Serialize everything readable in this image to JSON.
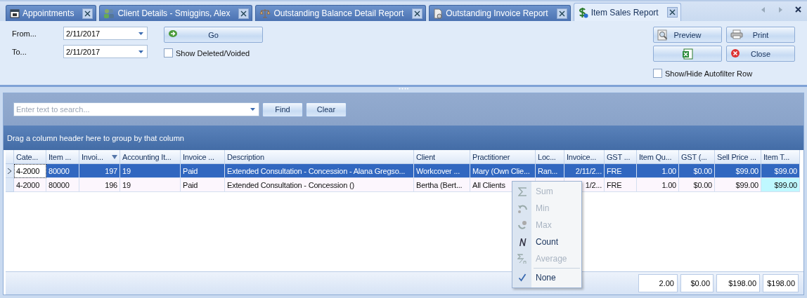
{
  "tabs": [
    {
      "label": "Appointments",
      "selected": false
    },
    {
      "label": "Client Details - Smiggins, Alex",
      "selected": false
    },
    {
      "label": "Outstanding Balance Detail Report",
      "selected": false
    },
    {
      "label": "Outstanding Invoice Report",
      "selected": false
    },
    {
      "label": "Item Sales Report",
      "selected": true
    }
  ],
  "filters": {
    "from_label": "From...",
    "from_value": "2/11/2017",
    "to_label": "To...",
    "to_value": "2/11/2017",
    "go_button": "Go",
    "show_deleted": {
      "label": "Show Deleted/Voided",
      "checked": false
    }
  },
  "actions": {
    "preview_button": "Preview",
    "print_button": "Print",
    "close_button": "Close",
    "autofilter": {
      "label": "Show/Hide Autofilter Row",
      "checked": false
    }
  },
  "search": {
    "placeholder": "Enter text to search...",
    "find_button": "Find",
    "clear_button": "Clear"
  },
  "group_panel": "Drag a column header here to group by that column",
  "table": {
    "columns": [
      {
        "label": "Cate...",
        "sorted": false
      },
      {
        "label": "Item ...",
        "sorted": false
      },
      {
        "label": "Invoi...",
        "sorted": true
      },
      {
        "label": "Accounting It...",
        "sorted": false
      },
      {
        "label": "Invoice ...",
        "sorted": false
      },
      {
        "label": "Description",
        "sorted": false
      },
      {
        "label": "Client",
        "sorted": false
      },
      {
        "label": "Practitioner",
        "sorted": false
      },
      {
        "label": "Loc...",
        "sorted": false
      },
      {
        "label": "Invoice...",
        "sorted": false
      },
      {
        "label": "GST ...",
        "sorted": false
      },
      {
        "label": "Item Qu...",
        "sorted": false
      },
      {
        "label": "GST (...",
        "sorted": false
      },
      {
        "label": "Sell Price ...",
        "sorted": false
      },
      {
        "label": "Item T...",
        "sorted": false
      }
    ],
    "rows": [
      {
        "selected": true,
        "cells": [
          "4-2000",
          "80000",
          "197",
          "19",
          "Paid",
          "Extended Consultation - Concession - Alana Gregso...",
          "Workcover ...",
          "Mary (Own Clie...",
          "Ran...",
          "2/11/2...",
          "FRE",
          "1.00",
          "$0.00",
          "$99.00",
          "$99.00"
        ]
      },
      {
        "selected": false,
        "cells": [
          "4-2000",
          "80000",
          "196",
          "19",
          "Paid",
          "Extended Consultation - Concession ()",
          "Bertha (Bert...",
          "All Clients",
          "",
          "1/2...",
          "FRE",
          "1.00",
          "$0.00",
          "$99.00",
          "$99.00"
        ]
      }
    ],
    "summary": [
      "2.00",
      "$0.00",
      "$198.00",
      "$198.00"
    ]
  },
  "summary_menu": {
    "items": [
      {
        "label": "Sum",
        "kind": "sum",
        "disabled": true,
        "checked": false
      },
      {
        "label": "Min",
        "kind": "min",
        "disabled": true,
        "checked": false
      },
      {
        "label": "Max",
        "kind": "max",
        "disabled": true,
        "checked": false
      },
      {
        "label": "Count",
        "kind": "count",
        "disabled": false,
        "checked": false
      },
      {
        "label": "Average",
        "kind": "average",
        "disabled": true,
        "checked": false
      },
      {
        "label": "None",
        "kind": "none",
        "disabled": false,
        "checked": true
      }
    ]
  }
}
